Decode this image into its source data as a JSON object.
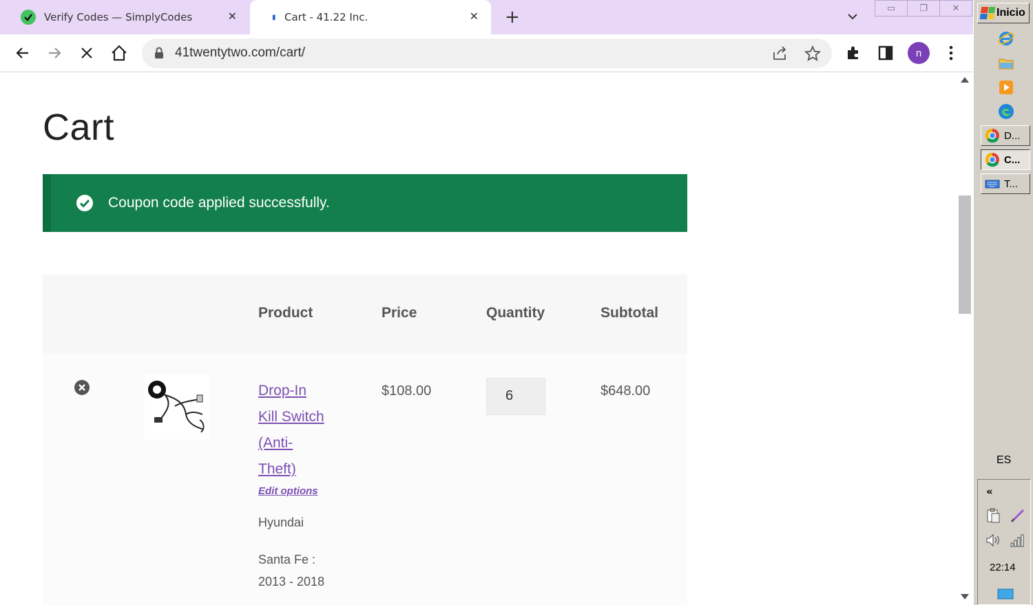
{
  "browser": {
    "tabs": [
      {
        "title": "Verify Codes — SimplyCodes",
        "icon": "simplycodes-icon"
      },
      {
        "title": "Cart - 41.22 Inc.",
        "icon": "loading-icon"
      }
    ],
    "url": "41twentytwo.com/cart/",
    "profile_initial": "n"
  },
  "page": {
    "title": "Cart",
    "notice": "Coupon code applied successfully.",
    "notice_color": "#137f4c",
    "table": {
      "headers": {
        "product": "Product",
        "price": "Price",
        "quantity": "Quantity",
        "subtotal": "Subtotal"
      },
      "item": {
        "name_lines": [
          "Drop-In",
          "Kill Switch",
          "(Anti-",
          "Theft)"
        ],
        "edit_label": "Edit options",
        "price": "$108.00",
        "quantity": "6",
        "subtotal": "$648.00",
        "meta_make": "Hyundai",
        "meta_model": "Santa Fe :",
        "meta_years": "2013 - 2018"
      }
    }
  },
  "taskbar": {
    "start_label": "Inicio",
    "tasks": [
      {
        "label": "D...",
        "icon": "chrome-icon"
      },
      {
        "label": "C...",
        "icon": "chrome-icon"
      },
      {
        "label": "T...",
        "icon": "keyboard-icon"
      }
    ],
    "language": "ES",
    "clock": "22:14"
  }
}
